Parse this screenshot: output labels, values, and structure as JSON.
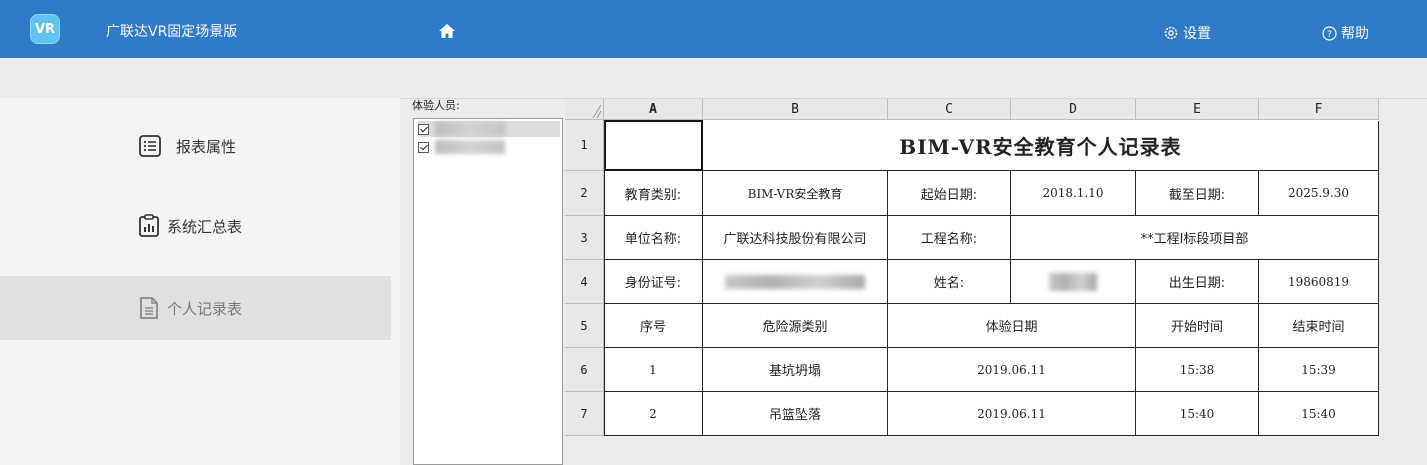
{
  "app": {
    "title": "广联达VR固定场景版",
    "logo_text": "VR",
    "settings_label": "设置",
    "help_label": "帮助",
    "accent": "#2f7bc9"
  },
  "sidebar": {
    "items": [
      {
        "label": "报表属性",
        "icon": "list-icon"
      },
      {
        "label": "系统汇总表",
        "icon": "bar-chart-icon"
      },
      {
        "label": "个人记录表",
        "icon": "document-icon",
        "active": true
      }
    ]
  },
  "people": {
    "label": "体验人员:",
    "entries": [
      {
        "checked": true
      },
      {
        "checked": true
      }
    ]
  },
  "sheet": {
    "columns": [
      "A",
      "B",
      "C",
      "D",
      "E",
      "F"
    ],
    "rows": [
      "1",
      "2",
      "3",
      "4",
      "5",
      "6",
      "7"
    ],
    "title": "BIM-VR安全教育个人记录表",
    "r2": {
      "edu_type_label": "教育类别:",
      "edu_type": "BIM-VR安全教育",
      "start_label": "起始日期:",
      "start": "2018.1.10",
      "end_label": "截至日期:",
      "end": "2025.9.30"
    },
    "r3": {
      "unit_label": "单位名称:",
      "unit": "广联达科技股份有限公司",
      "project_label": "工程名称:",
      "project": "**工程Ⅰ标段项目部"
    },
    "r4": {
      "id_label": "身份证号:",
      "name_label": "姓名:",
      "birth_label": "出生日期:",
      "birth": "19860819"
    },
    "r5": {
      "seq": "序号",
      "hazard": "危险源类别",
      "date": "体验日期",
      "start_time": "开始时间",
      "end_time": "结束时间"
    },
    "records": [
      {
        "seq": "1",
        "hazard": "基坑坍塌",
        "date": "2019.06.11",
        "start": "15:38",
        "end": "15:39"
      },
      {
        "seq": "2",
        "hazard": "吊篮坠落",
        "date": "2019.06.11",
        "start": "15:40",
        "end": "15:40"
      }
    ]
  }
}
